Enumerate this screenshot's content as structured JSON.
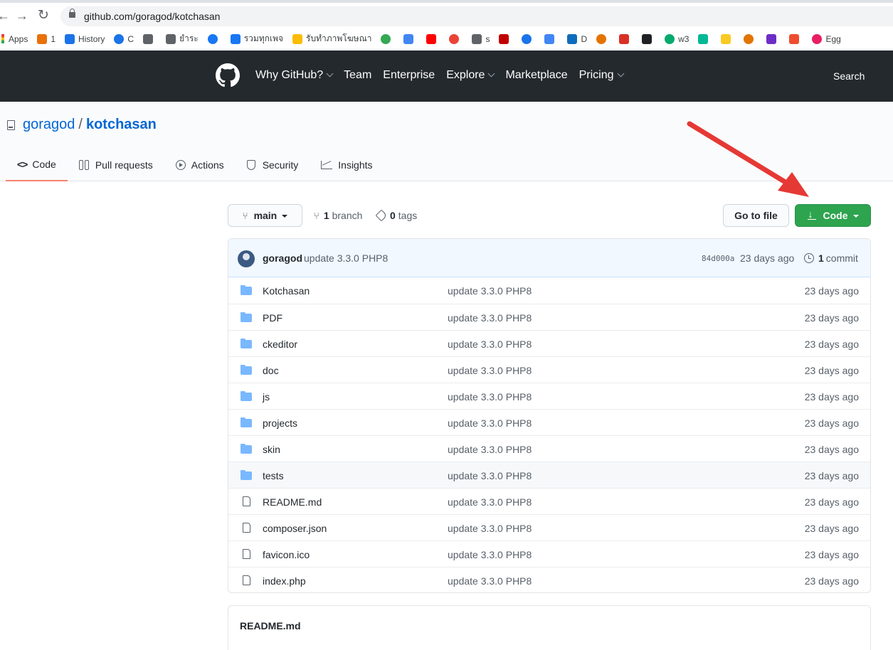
{
  "browser": {
    "url": "github.com/goragod/kotchasan",
    "bookmarks": [
      {
        "label": "Apps",
        "color": "#ea4335"
      },
      {
        "label": "1",
        "color": "#e8710a"
      },
      {
        "label": "History",
        "color": "#1a73e8"
      },
      {
        "label": "C",
        "color": "#1a73e8"
      },
      {
        "label": "",
        "color": "#5f6368"
      },
      {
        "label": "ยำระ",
        "color": "#5f6368"
      },
      {
        "label": "",
        "color": "#1877f2"
      },
      {
        "label": "รวมทุกเพจ",
        "color": "#1877f2"
      },
      {
        "label": "รับทำภาพโฆษณา",
        "color": "#fbbc04"
      },
      {
        "label": "",
        "color": "#34a853"
      },
      {
        "label": "",
        "color": "#4285f4"
      },
      {
        "label": "",
        "color": "#ff0000"
      },
      {
        "label": "",
        "color": "#ea4335"
      },
      {
        "label": "s",
        "color": "#5f6368"
      },
      {
        "label": "",
        "color": "#c00000"
      },
      {
        "label": "",
        "color": "#1a73e8"
      },
      {
        "label": "",
        "color": "#4285f4"
      },
      {
        "label": "D",
        "color": "#0f6cbd"
      },
      {
        "label": "",
        "color": "#e37400"
      },
      {
        "label": "",
        "color": "#d93025"
      },
      {
        "label": "",
        "color": "#202124"
      },
      {
        "label": "w3",
        "color": "#04aa6d"
      },
      {
        "label": "",
        "color": "#00b894"
      },
      {
        "label": "",
        "color": "#f9ca24"
      },
      {
        "label": "",
        "color": "#e37400"
      },
      {
        "label": "",
        "color": "#6c2dc7"
      },
      {
        "label": "",
        "color": "#ee4d2d"
      },
      {
        "label": "Egg",
        "color": "#e91e63"
      }
    ]
  },
  "header": {
    "nav": [
      "Why GitHub?",
      "Team",
      "Enterprise",
      "Explore",
      "Marketplace",
      "Pricing"
    ],
    "search_label": "Search"
  },
  "repo": {
    "owner": "goragod",
    "separator": "/",
    "name": "kotchasan"
  },
  "tabs": [
    {
      "icon": "code-icon",
      "label": "Code",
      "active": true
    },
    {
      "icon": "pull-request-icon",
      "label": "Pull requests"
    },
    {
      "icon": "actions-icon",
      "label": "Actions"
    },
    {
      "icon": "shield-icon",
      "label": "Security"
    },
    {
      "icon": "graph-icon",
      "label": "Insights"
    }
  ],
  "toolbar": {
    "branch_name": "main",
    "branch_count": "1",
    "branch_label": "branch",
    "tag_count": "0",
    "tag_label": "tags",
    "goto_file_label": "Go to file",
    "code_label": "Code"
  },
  "commit": {
    "author": "goragod",
    "message": "update 3.3.0 PHP8",
    "sha": "84d000a",
    "age": "23 days ago",
    "count": "1",
    "count_label": "commit"
  },
  "files": [
    {
      "type": "dir",
      "name": "Kotchasan",
      "message": "update 3.3.0 PHP8",
      "age": "23 days ago"
    },
    {
      "type": "dir",
      "name": "PDF",
      "message": "update 3.3.0 PHP8",
      "age": "23 days ago"
    },
    {
      "type": "dir",
      "name": "ckeditor",
      "message": "update 3.3.0 PHP8",
      "age": "23 days ago"
    },
    {
      "type": "dir",
      "name": "doc",
      "message": "update 3.3.0 PHP8",
      "age": "23 days ago"
    },
    {
      "type": "dir",
      "name": "js",
      "message": "update 3.3.0 PHP8",
      "age": "23 days ago"
    },
    {
      "type": "dir",
      "name": "projects",
      "message": "update 3.3.0 PHP8",
      "age": "23 days ago"
    },
    {
      "type": "dir",
      "name": "skin",
      "message": "update 3.3.0 PHP8",
      "age": "23 days ago"
    },
    {
      "type": "dir",
      "name": "tests",
      "message": "update 3.3.0 PHP8",
      "age": "23 days ago"
    },
    {
      "type": "file",
      "name": "README.md",
      "message": "update 3.3.0 PHP8",
      "age": "23 days ago"
    },
    {
      "type": "file",
      "name": "composer.json",
      "message": "update 3.3.0 PHP8",
      "age": "23 days ago"
    },
    {
      "type": "file",
      "name": "favicon.ico",
      "message": "update 3.3.0 PHP8",
      "age": "23 days ago"
    },
    {
      "type": "file",
      "name": "index.php",
      "message": "update 3.3.0 PHP8",
      "age": "23 days ago"
    }
  ],
  "readme": {
    "title": "README.md"
  },
  "colors": {
    "header_bg": "#24292e",
    "code_button": "#2ea44f",
    "link": "#0366d6",
    "annotation_arrow": "#e53935"
  }
}
